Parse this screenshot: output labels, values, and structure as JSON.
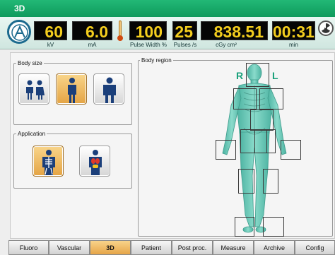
{
  "window": {
    "title": "3D"
  },
  "readouts": [
    {
      "id": "kv",
      "value": "60",
      "unit": "kV"
    },
    {
      "id": "ma",
      "value": "6.0",
      "unit": "mA"
    },
    {
      "id": "pulse-width",
      "value": "100",
      "unit": "Pulse Width %"
    },
    {
      "id": "pulses",
      "value": "25",
      "unit": "Pulses /s"
    },
    {
      "id": "dose",
      "value": "838.51",
      "unit": "cGy cm²"
    },
    {
      "id": "time",
      "value": "00:31",
      "unit": "min"
    }
  ],
  "body_size": {
    "legend": "Body size",
    "options": [
      {
        "name": "children",
        "icon": "children-icon",
        "selected": false
      },
      {
        "name": "adult-small",
        "icon": "person-icon",
        "selected": true
      },
      {
        "name": "adult-large",
        "icon": "large-person-icon",
        "selected": false
      }
    ]
  },
  "application": {
    "legend": "Application",
    "options": [
      {
        "name": "skeletal",
        "icon": "skeleton-icon",
        "selected": true
      },
      {
        "name": "organs",
        "icon": "organs-icon",
        "selected": false
      }
    ]
  },
  "body_region": {
    "legend": "Body region",
    "right_label": "R",
    "left_label": "L"
  },
  "tabs": [
    {
      "label": "Fluoro",
      "active": false
    },
    {
      "label": "Vascular",
      "active": false
    },
    {
      "label": "3D",
      "active": true
    },
    {
      "label": "Patient",
      "active": false
    },
    {
      "label": "Post proc.",
      "active": false
    },
    {
      "label": "Measure",
      "active": false
    },
    {
      "label": "Archive",
      "active": false
    },
    {
      "label": "Config",
      "active": false
    }
  ],
  "colors": {
    "titlebar": "#13a565",
    "readout_text": "#f4ce1e",
    "active_button": "#e4a444",
    "body_tint": "#6fc9b8"
  }
}
